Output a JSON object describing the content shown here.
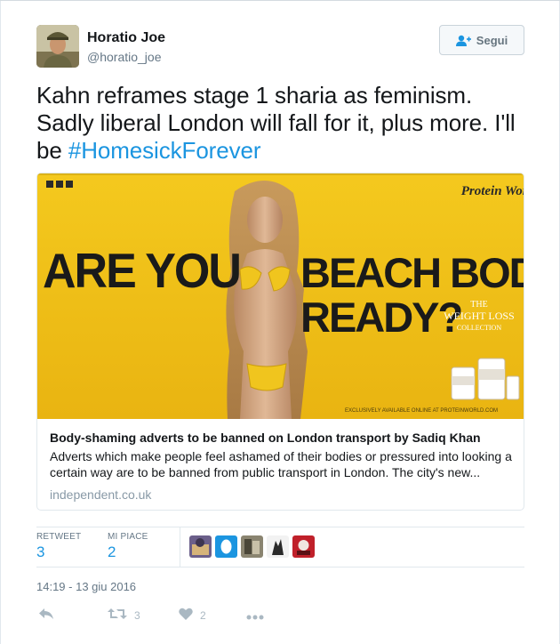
{
  "author": {
    "name": "Horatio Joe",
    "handle": "@horatio_joe"
  },
  "follow_button": {
    "label": "Segui",
    "icon": "follow-person-plus-icon"
  },
  "tweet": {
    "text_before": "Kahn reframes stage 1 sharia as feminism. Sadly liberal London will fall for it, plus more. I'll be ",
    "hashtag": "#HomesickForever"
  },
  "card": {
    "image": {
      "headline_line1": "ARE YOU",
      "headline_line2": "BEACH BODY",
      "headline_line3": "READY?",
      "brand": "Protein World",
      "collection_top": "THE",
      "collection_main": "WEIGHT LOSS",
      "collection_bottom": "COLLECTION",
      "footer": "EXCLUSIVELY AVAILABLE ONLINE AT PROTEINWORLD.COM"
    },
    "title": "Body-shaming adverts to be banned on London transport by Sadiq Khan",
    "description": "Adverts which make people feel ashamed of their bodies or pressured into looking a certain way are to be banned from public transport in London. The city's new...",
    "domain": "independent.co.uk"
  },
  "stats": {
    "retweets_label": "RETWEET",
    "retweets": "3",
    "likes_label": "MI PIACE",
    "likes": "2",
    "liker_avatars": [
      "avatar-1",
      "avatar-2",
      "avatar-3",
      "avatar-4",
      "avatar-5"
    ]
  },
  "timestamp": "14:19 - 13 giu 2016",
  "actions": {
    "reply_icon": "reply-icon",
    "retweet_icon": "retweet-icon",
    "retweet_count": "3",
    "like_icon": "heart-icon",
    "like_count": "2",
    "more_icon": "more-dots-icon"
  },
  "colors": {
    "link": "#1b95e0",
    "muted": "#657786",
    "card_yellow": "#f2c21a"
  }
}
